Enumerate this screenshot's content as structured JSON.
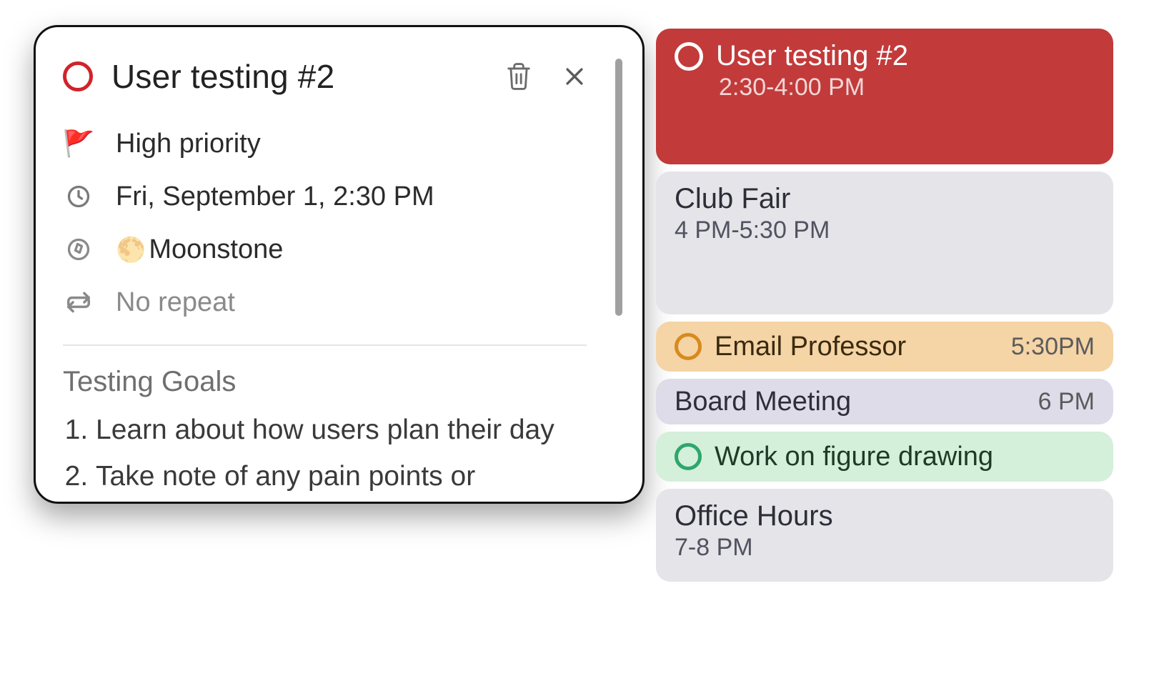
{
  "detail": {
    "title": "User testing #2",
    "priority": "High priority",
    "datetime": "Fri, September 1, 2:30 PM",
    "location_emoji": "🌕",
    "location": "Moonstone",
    "repeat": "No repeat",
    "notes_heading": "Testing Goals",
    "notes": [
      "Learn about how users plan their day",
      "Take note of any pain points or"
    ]
  },
  "timeline": [
    {
      "title": "User testing #2",
      "time": "2:30-4:00 PM",
      "style": "red",
      "radio": "white",
      "height": "h-190",
      "compact": false
    },
    {
      "title": "Club Fair",
      "time": "4 PM-5:30 PM",
      "style": "grey",
      "radio": "",
      "height": "h-200",
      "compact": false
    },
    {
      "title": "Email Professor",
      "time": "5:30PM",
      "style": "peach",
      "radio": "orange",
      "height": "h-70",
      "compact": true
    },
    {
      "title": "Board Meeting",
      "time": "6 PM",
      "style": "lav",
      "radio": "",
      "height": "h-64",
      "compact": true
    },
    {
      "title": "Work on figure drawing",
      "time": "",
      "style": "mint",
      "radio": "green",
      "height": "h-70",
      "compact": true
    },
    {
      "title": "Office Hours",
      "time": "7-8 PM",
      "style": "grey2",
      "radio": "",
      "height": "h-130",
      "compact": false
    }
  ]
}
